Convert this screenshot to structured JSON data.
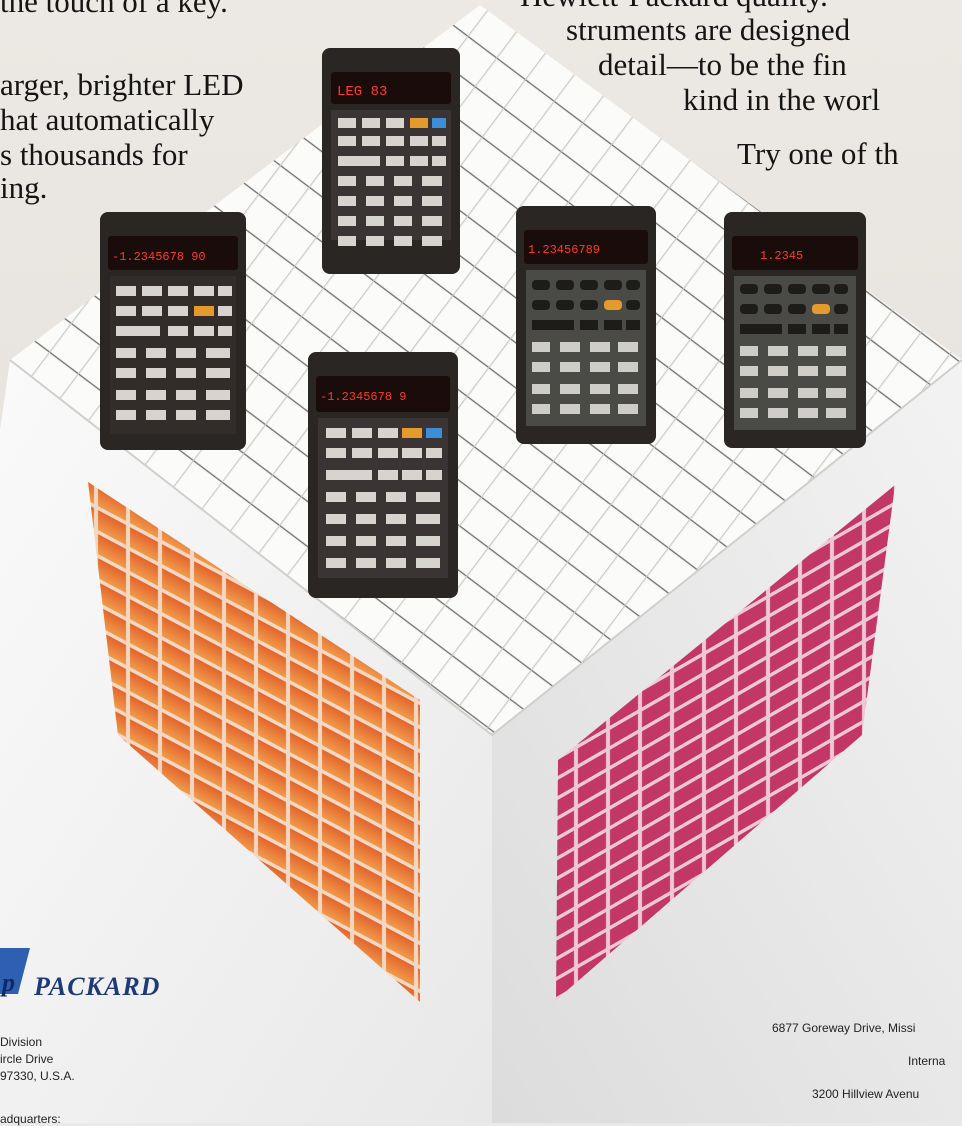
{
  "headline_left": {
    "line1": "the touch of a key.",
    "line2": "arger, brighter LED",
    "line3": "hat automatically",
    "line4": "s thousands for",
    "line5": "ing."
  },
  "headline_right": {
    "line1": "Hewlett-Packard quality.",
    "line2": "struments are designed",
    "line3": "detail—to be the fin",
    "line4": "kind in the worl",
    "line5": "Try one of th"
  },
  "brand": {
    "name": "PACKARD",
    "colors": {
      "logo": "#1e3a78",
      "logo_mark": "#2f5fb0"
    }
  },
  "address_left": {
    "line1": "Division",
    "line2": "ircle Drive",
    "line3": "97330, U.S.A.",
    "line4": "adquarters:"
  },
  "address_right": {
    "line1": "6877 Goreway Drive, Missi",
    "line2": "Interna",
    "line3": "3200 Hillview Avenu"
  },
  "calculators": [
    {
      "display": "LEG  83"
    },
    {
      "display": "-1.2345678 90"
    },
    {
      "display": "-1.2345678 9"
    },
    {
      "display": "1.23456789"
    },
    {
      "display": "1.2345"
    }
  ],
  "colors": {
    "left_face": "#e2712f",
    "right_face": "#c83a6a",
    "cube_top": "#f3f2ef",
    "calc_body": "#2a2624",
    "led": "#ff3a2a"
  }
}
